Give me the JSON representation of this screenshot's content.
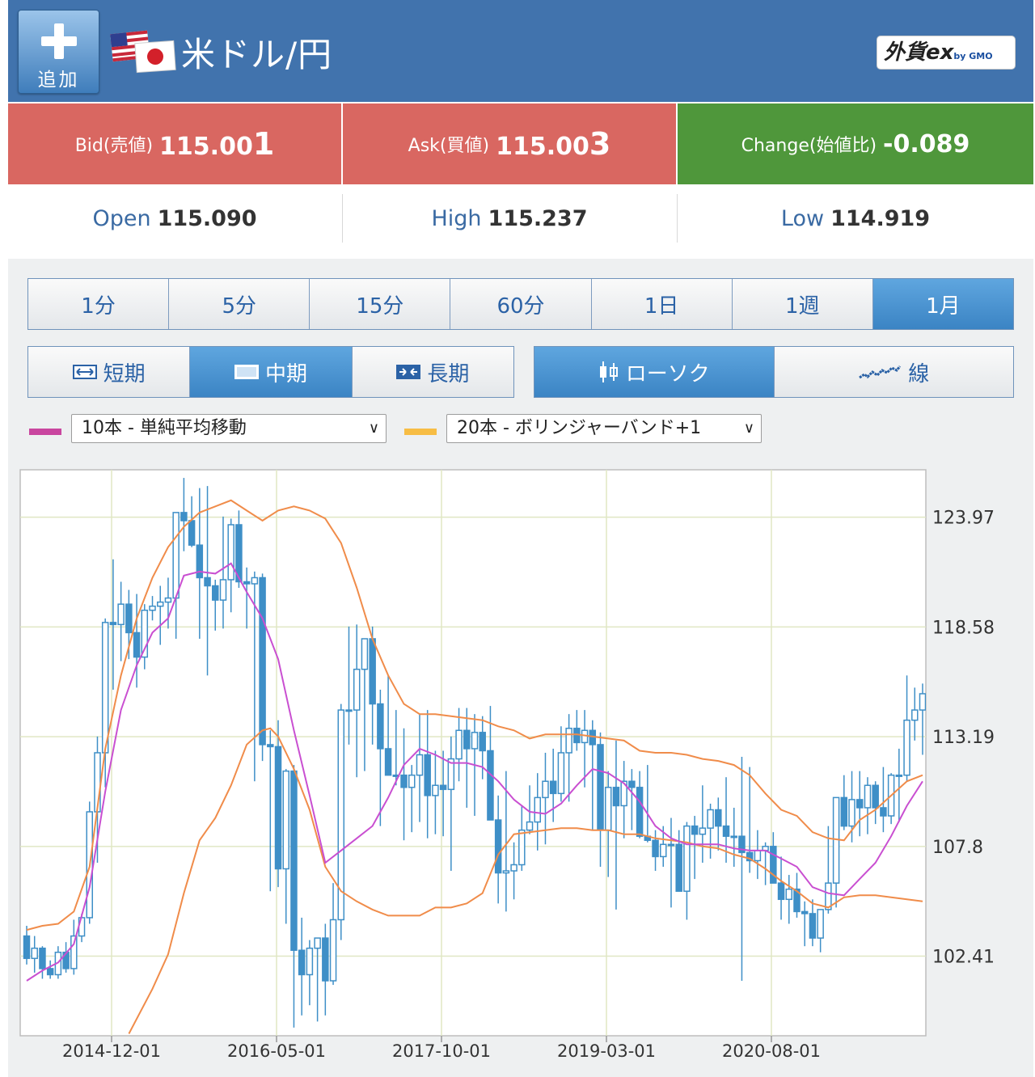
{
  "header": {
    "add_label": "追加",
    "title": "米ドル/円",
    "brand": "外貨ex",
    "brand_sub": "by GMO"
  },
  "quotes": {
    "bid_label": "Bid(売値)",
    "bid_main": "115.00",
    "bid_last": "1",
    "ask_label": "Ask(買値)",
    "ask_main": "115.00",
    "ask_last": "3",
    "change_label": "Change(始値比)",
    "change_value": "-0.089"
  },
  "ohl": {
    "open_label": "Open",
    "open_value": "115.090",
    "high_label": "High",
    "high_value": "115.237",
    "low_label": "Low",
    "low_value": "114.919"
  },
  "timeframes": [
    "1分",
    "5分",
    "15分",
    "60分",
    "1日",
    "1週",
    "1月"
  ],
  "selected_timeframe": "1月",
  "periods": [
    "短期",
    "中期",
    "長期"
  ],
  "selected_period": "中期",
  "chart_types": [
    "ローソク",
    "線"
  ],
  "selected_chart_type": "ローソク",
  "indicator1": {
    "color": "#c9469f",
    "value": "10本 - 単純平均移動"
  },
  "indicator2": {
    "color": "#f7bd45",
    "value": "20本 - ボリンジャーバンド+1"
  },
  "chart_data": {
    "type": "candlestick",
    "xlabels": [
      "2014-12-01",
      "2016-05-01",
      "2017-10-01",
      "2019-03-01",
      "2020-08-01"
    ],
    "ylabels": [
      123.97,
      118.58,
      113.19,
      107.8,
      102.41
    ],
    "ylim": [
      98.5,
      126.3
    ],
    "grid": true,
    "colors": {
      "candle": "#3e8fc7",
      "sma": "#c94fd1",
      "band": "#f08c4a",
      "grid": "#e0e7c4"
    },
    "candles": [
      [
        103.4,
        103.9,
        102.0,
        102.3
      ],
      [
        102.3,
        103.4,
        101.6,
        102.8
      ],
      [
        102.8,
        102.9,
        101.3,
        101.8
      ],
      [
        101.8,
        102.2,
        101.3,
        101.5
      ],
      [
        101.5,
        102.9,
        101.3,
        102.6
      ],
      [
        102.6,
        103.1,
        101.6,
        101.8
      ],
      [
        101.8,
        104.2,
        101.5,
        103.4
      ],
      [
        103.4,
        104.5,
        103.1,
        104.3
      ],
      [
        104.3,
        110.0,
        104.0,
        109.5
      ],
      [
        109.5,
        113.2,
        107.0,
        112.4
      ],
      [
        112.4,
        119.0,
        110.7,
        118.8
      ],
      [
        118.8,
        121.9,
        115.5,
        118.7
      ],
      [
        118.7,
        120.8,
        116.9,
        119.7
      ],
      [
        119.7,
        120.4,
        117.0,
        118.3
      ],
      [
        118.3,
        120.2,
        115.6,
        117.1
      ],
      [
        117.1,
        119.7,
        116.5,
        119.4
      ],
      [
        119.4,
        120.1,
        118.9,
        119.6
      ],
      [
        119.6,
        120.6,
        117.7,
        119.8
      ],
      [
        119.8,
        121.0,
        118.5,
        120.0
      ],
      [
        120.0,
        123.4,
        118.0,
        124.2
      ],
      [
        124.2,
        125.9,
        122.3,
        123.8
      ],
      [
        123.8,
        125.0,
        122.5,
        122.6
      ],
      [
        122.6,
        125.4,
        118.0,
        121.0
      ],
      [
        121.0,
        125.5,
        116.2,
        120.6
      ],
      [
        120.6,
        120.9,
        118.4,
        119.9
      ],
      [
        119.9,
        124.0,
        118.5,
        120.9
      ],
      [
        120.9,
        123.9,
        119.3,
        123.6
      ],
      [
        123.6,
        124.3,
        120.5,
        120.8
      ],
      [
        120.8,
        121.5,
        118.5,
        120.7
      ],
      [
        120.7,
        121.3,
        111.0,
        121.0
      ],
      [
        121.0,
        121.2,
        112.0,
        112.8
      ],
      [
        112.8,
        113.5,
        105.6,
        112.7
      ],
      [
        112.7,
        114.0,
        105.8,
        106.7
      ],
      [
        106.7,
        111.6,
        104.0,
        111.5
      ],
      [
        111.5,
        111.8,
        98.9,
        102.7
      ],
      [
        102.7,
        104.3,
        99.5,
        101.5
      ],
      [
        101.5,
        103.2,
        100.0,
        102.8
      ],
      [
        102.8,
        103.3,
        99.2,
        103.3
      ],
      [
        103.3,
        104.0,
        99.5,
        101.2
      ],
      [
        101.2,
        106.0,
        101.0,
        104.2
      ],
      [
        104.2,
        114.8,
        103.2,
        114.5
      ],
      [
        114.5,
        118.6,
        112.8,
        114.5
      ],
      [
        114.5,
        118.7,
        111.2,
        116.5
      ],
      [
        116.5,
        117.5,
        111.5,
        118.0
      ],
      [
        118.0,
        118.6,
        112.8,
        114.8
      ],
      [
        114.8,
        115.5,
        108.8,
        112.6
      ],
      [
        112.6,
        116.2,
        111.3,
        111.3
      ],
      [
        111.3,
        114.5,
        110.8,
        111.3
      ],
      [
        111.3,
        113.6,
        108.1,
        110.7
      ],
      [
        110.7,
        111.8,
        108.5,
        111.3
      ],
      [
        111.3,
        114.3,
        109.0,
        112.3
      ],
      [
        112.3,
        114.5,
        108.2,
        110.3
      ],
      [
        110.3,
        112.5,
        108.4,
        110.8
      ],
      [
        110.8,
        112.5,
        108.3,
        110.6
      ],
      [
        110.6,
        113.2,
        106.6,
        112.1
      ],
      [
        112.1,
        114.6,
        111.0,
        113.5
      ],
      [
        113.5,
        114.6,
        109.7,
        112.6
      ],
      [
        112.6,
        114.3,
        109.3,
        113.4
      ],
      [
        113.4,
        114.2,
        111.1,
        112.5
      ],
      [
        112.5,
        114.7,
        111.0,
        109.1
      ],
      [
        109.1,
        110.3,
        105.0,
        106.5
      ],
      [
        106.5,
        111.5,
        104.6,
        106.6
      ],
      [
        106.6,
        108.0,
        105.2,
        106.9
      ],
      [
        106.9,
        109.8,
        106.6,
        108.6
      ],
      [
        108.6,
        110.8,
        108.4,
        109.0
      ],
      [
        109.0,
        111.4,
        107.6,
        110.2
      ],
      [
        110.2,
        112.4,
        107.9,
        111.0
      ],
      [
        111.0,
        112.6,
        109.0,
        110.4
      ],
      [
        110.4,
        113.7,
        110.0,
        112.4
      ],
      [
        112.4,
        114.3,
        110.0,
        113.6
      ],
      [
        113.6,
        114.5,
        112.5,
        112.9
      ],
      [
        112.9,
        114.5,
        110.7,
        113.5
      ],
      [
        113.5,
        114.0,
        108.6,
        112.8
      ],
      [
        112.8,
        113.4,
        106.8,
        108.6
      ],
      [
        108.6,
        111.5,
        106.3,
        110.7
      ],
      [
        110.7,
        113.0,
        104.7,
        109.8
      ],
      [
        109.8,
        112.0,
        108.2,
        111.0
      ],
      [
        111.0,
        111.6,
        108.6,
        110.7
      ],
      [
        110.7,
        111.5,
        108.2,
        108.3
      ],
      [
        108.3,
        111.8,
        108.0,
        108.1
      ],
      [
        108.1,
        108.6,
        106.6,
        107.3
      ],
      [
        107.3,
        108.8,
        106.8,
        107.9
      ],
      [
        107.9,
        109.2,
        104.8,
        107.9
      ],
      [
        107.9,
        108.6,
        106.0,
        105.6
      ],
      [
        105.6,
        109.0,
        104.2,
        108.8
      ],
      [
        108.8,
        109.3,
        106.2,
        108.4
      ],
      [
        108.4,
        110.8,
        107.0,
        108.7
      ],
      [
        108.7,
        109.9,
        107.2,
        109.6
      ],
      [
        109.6,
        110.2,
        107.6,
        108.8
      ],
      [
        108.8,
        111.2,
        107.0,
        108.3
      ],
      [
        108.3,
        109.7,
        106.8,
        108.3
      ],
      [
        108.3,
        112.2,
        101.2,
        107.5
      ],
      [
        107.5,
        111.7,
        106.5,
        107.1
      ],
      [
        107.1,
        108.6,
        106.2,
        107.6
      ],
      [
        107.6,
        108.0,
        105.9,
        107.8
      ],
      [
        107.8,
        108.5,
        106.1,
        106.0
      ],
      [
        106.0,
        107.3,
        104.2,
        105.2
      ],
      [
        105.2,
        106.4,
        104.0,
        105.7
      ],
      [
        105.7,
        106.5,
        104.3,
        104.6
      ],
      [
        104.6,
        105.1,
        102.9,
        104.5
      ],
      [
        104.5,
        105.2,
        102.9,
        103.3
      ],
      [
        103.3,
        104.7,
        102.6,
        104.7
      ],
      [
        104.7,
        108.8,
        104.5,
        106.0
      ],
      [
        106.0,
        107.5,
        104.8,
        110.2
      ],
      [
        110.2,
        111.3,
        108.6,
        108.8
      ],
      [
        108.8,
        111.5,
        108.0,
        110.1
      ],
      [
        110.1,
        111.5,
        108.3,
        109.7
      ],
      [
        109.7,
        111.2,
        108.4,
        110.8
      ],
      [
        110.8,
        111.0,
        108.9,
        109.7
      ],
      [
        109.7,
        111.7,
        108.5,
        109.3
      ],
      [
        109.3,
        111.4,
        108.9,
        111.3
      ],
      [
        111.3,
        112.6,
        109.0,
        111.3
      ],
      [
        111.3,
        116.2,
        111.0,
        114.0
      ],
      [
        114.0,
        115.6,
        113.0,
        114.5
      ],
      [
        114.5,
        115.8,
        112.3,
        115.3
      ]
    ],
    "sma": [
      [
        0,
        101.2
      ],
      [
        2,
        101.7
      ],
      [
        4,
        102.1
      ],
      [
        6,
        103.0
      ],
      [
        8,
        105.8
      ],
      [
        10,
        110.5
      ],
      [
        12,
        114.5
      ],
      [
        14,
        116.7
      ],
      [
        16,
        118.3
      ],
      [
        18,
        119.0
      ],
      [
        20,
        121.1
      ],
      [
        22,
        121.3
      ],
      [
        24,
        121.2
      ],
      [
        26,
        121.7
      ],
      [
        28,
        120.3
      ],
      [
        30,
        119.0
      ],
      [
        32,
        117.0
      ],
      [
        34,
        113.5
      ],
      [
        36,
        110.3
      ],
      [
        38,
        107.0
      ],
      [
        40,
        107.6
      ],
      [
        42,
        108.2
      ],
      [
        44,
        108.8
      ],
      [
        46,
        110.2
      ],
      [
        48,
        111.8
      ],
      [
        50,
        112.6
      ],
      [
        52,
        112.3
      ],
      [
        54,
        111.9
      ],
      [
        56,
        111.9
      ],
      [
        58,
        111.7
      ],
      [
        60,
        111.0
      ],
      [
        62,
        110.1
      ],
      [
        64,
        109.5
      ],
      [
        66,
        109.4
      ],
      [
        68,
        109.9
      ],
      [
        70,
        110.8
      ],
      [
        72,
        111.6
      ],
      [
        74,
        111.4
      ],
      [
        76,
        110.9
      ],
      [
        78,
        110.0
      ],
      [
        80,
        108.8
      ],
      [
        82,
        108.2
      ],
      [
        84,
        107.9
      ],
      [
        86,
        107.9
      ],
      [
        88,
        107.9
      ],
      [
        90,
        107.7
      ],
      [
        92,
        107.6
      ],
      [
        94,
        107.6
      ],
      [
        96,
        107.2
      ],
      [
        98,
        106.8
      ],
      [
        100,
        105.8
      ],
      [
        102,
        105.5
      ],
      [
        104,
        105.4
      ],
      [
        106,
        106.2
      ],
      [
        108,
        107.0
      ],
      [
        110,
        108.3
      ],
      [
        112,
        109.8
      ],
      [
        114,
        111.0
      ]
    ],
    "band_upper": [
      [
        0,
        103.7
      ],
      [
        2,
        103.9
      ],
      [
        4,
        104.0
      ],
      [
        6,
        104.6
      ],
      [
        8,
        106.8
      ],
      [
        10,
        112.6
      ],
      [
        12,
        116.2
      ],
      [
        14,
        119.0
      ],
      [
        16,
        121.0
      ],
      [
        18,
        122.5
      ],
      [
        20,
        123.5
      ],
      [
        22,
        124.2
      ],
      [
        24,
        124.5
      ],
      [
        26,
        124.8
      ],
      [
        28,
        124.3
      ],
      [
        30,
        123.8
      ],
      [
        32,
        124.3
      ],
      [
        34,
        124.5
      ],
      [
        36,
        124.3
      ],
      [
        38,
        123.9
      ],
      [
        40,
        122.7
      ],
      [
        42,
        120.5
      ],
      [
        44,
        118.0
      ],
      [
        46,
        116.2
      ],
      [
        48,
        114.8
      ],
      [
        50,
        114.3
      ],
      [
        52,
        114.3
      ],
      [
        54,
        114.2
      ],
      [
        56,
        114.1
      ],
      [
        58,
        114.0
      ],
      [
        60,
        113.7
      ],
      [
        62,
        113.5
      ],
      [
        64,
        113.1
      ],
      [
        66,
        113.3
      ],
      [
        68,
        113.3
      ],
      [
        70,
        113.3
      ],
      [
        72,
        113.2
      ],
      [
        74,
        113.1
      ],
      [
        76,
        113.0
      ],
      [
        78,
        112.5
      ],
      [
        80,
        112.4
      ],
      [
        82,
        112.4
      ],
      [
        84,
        112.3
      ],
      [
        86,
        112.1
      ],
      [
        88,
        112.0
      ],
      [
        90,
        111.8
      ],
      [
        92,
        111.3
      ],
      [
        94,
        110.4
      ],
      [
        96,
        109.6
      ],
      [
        98,
        109.3
      ],
      [
        100,
        108.5
      ],
      [
        102,
        108.2
      ],
      [
        104,
        108.1
      ],
      [
        106,
        109.1
      ],
      [
        108,
        109.6
      ],
      [
        110,
        110.3
      ],
      [
        112,
        111.0
      ],
      [
        114,
        111.3
      ]
    ],
    "band_lower": [
      [
        13,
        98.6
      ],
      [
        16,
        100.8
      ],
      [
        18,
        102.5
      ],
      [
        20,
        105.5
      ],
      [
        22,
        108.1
      ],
      [
        24,
        109.2
      ],
      [
        26,
        110.8
      ],
      [
        28,
        112.8
      ],
      [
        30,
        113.5
      ],
      [
        31,
        113.6
      ],
      [
        32,
        113.2
      ],
      [
        34,
        111.6
      ],
      [
        36,
        109.6
      ],
      [
        38,
        106.8
      ],
      [
        40,
        105.6
      ],
      [
        42,
        105.1
      ],
      [
        44,
        104.7
      ],
      [
        46,
        104.4
      ],
      [
        48,
        104.4
      ],
      [
        50,
        104.4
      ],
      [
        52,
        104.8
      ],
      [
        54,
        104.8
      ],
      [
        56,
        105.0
      ],
      [
        58,
        105.5
      ],
      [
        60,
        107.4
      ],
      [
        62,
        108.4
      ],
      [
        64,
        108.5
      ],
      [
        66,
        108.6
      ],
      [
        68,
        108.7
      ],
      [
        70,
        108.7
      ],
      [
        72,
        108.6
      ],
      [
        74,
        108.6
      ],
      [
        76,
        108.4
      ],
      [
        78,
        108.4
      ],
      [
        80,
        108.2
      ],
      [
        82,
        108.1
      ],
      [
        84,
        108.0
      ],
      [
        86,
        107.8
      ],
      [
        88,
        107.7
      ],
      [
        90,
        107.4
      ],
      [
        92,
        107.2
      ],
      [
        94,
        106.7
      ],
      [
        96,
        106.1
      ],
      [
        98,
        105.6
      ],
      [
        100,
        105.0
      ],
      [
        102,
        104.8
      ],
      [
        104,
        105.3
      ],
      [
        106,
        105.4
      ],
      [
        108,
        105.4
      ],
      [
        110,
        105.3
      ],
      [
        112,
        105.2
      ],
      [
        114,
        105.1
      ]
    ]
  }
}
